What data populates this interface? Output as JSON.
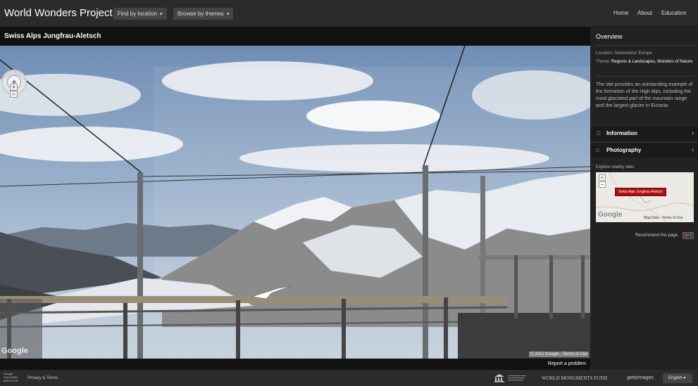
{
  "header": {
    "brand": "World Wonders Project",
    "find_by_location": "Find by location",
    "browse_by_themes": "Browse by themes",
    "caret_glyph": "▾",
    "nav": [
      "Home",
      "About",
      "Education"
    ]
  },
  "viewer": {
    "title": "Swiss Alps Jungfrau-Aletsch",
    "compass_north": "N",
    "zoom_in": "+",
    "zoom_out": "−",
    "google": "Google",
    "copyright": "© 2012 Google - Terms of Use",
    "report": "Report a problem"
  },
  "sidebar": {
    "heading": "Overview",
    "location_label": "Location:",
    "location_value": "Switzerland, Europe",
    "theme_label": "Theme:",
    "theme_value": "Regions & Landscapes, Wonders of Nature",
    "description": "The site provides an outstanding example of the formation of the High Alps, including the most glaciated part of the mountain range and the largest glacier in Eurasia.",
    "accordion": [
      {
        "label": "Information",
        "icon": "list-icon",
        "icon_glyph": "☰",
        "chevron": "›"
      },
      {
        "label": "Photography",
        "icon": "camera-icon",
        "icon_glyph": "◘",
        "chevron": "›"
      }
    ],
    "nearby_label": "Explore nearby sites",
    "map_pin": "Swiss Alps Jungfrau-Aletsch",
    "map_zoom_in": "+",
    "map_zoom_out": "−",
    "map_google": "Google",
    "map_data": "Map Data",
    "map_terms": "Terms of Use",
    "recommend": "Recommend this page",
    "gplus": "g+1"
  },
  "footer": {
    "gci_line1": "Google",
    "gci_line2": "CULTURAL",
    "gci_line3": "INSTITUTE",
    "privacy": "Privacy & Terms",
    "partner_wmf": "WORLD MONUMENTS FUND",
    "partner_getty": "gettyimages",
    "language": "English",
    "language_caret": "▾"
  }
}
